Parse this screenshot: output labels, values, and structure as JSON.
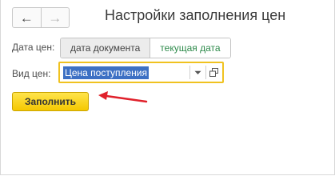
{
  "window": {
    "title": "Настройки заполнения цен"
  },
  "nav": {
    "back_icon": "arrow-left-icon",
    "forward_icon": "arrow-right-icon",
    "back_glyph": "←",
    "forward_glyph": "→"
  },
  "price_date": {
    "label": "Дата цен:",
    "options": [
      "дата документа",
      "текущая дата"
    ],
    "selected": "текущая дата"
  },
  "price_type": {
    "label": "Вид цен:",
    "value": "Цена поступления"
  },
  "actions": {
    "fill_label": "Заполнить"
  },
  "colors": {
    "accent_yellow": "#f5c800",
    "focus_border": "#f0c220",
    "selection_blue": "#3d70c4",
    "selected_text_green": "#2d8a4a",
    "annotation_arrow": "#e0212b"
  }
}
